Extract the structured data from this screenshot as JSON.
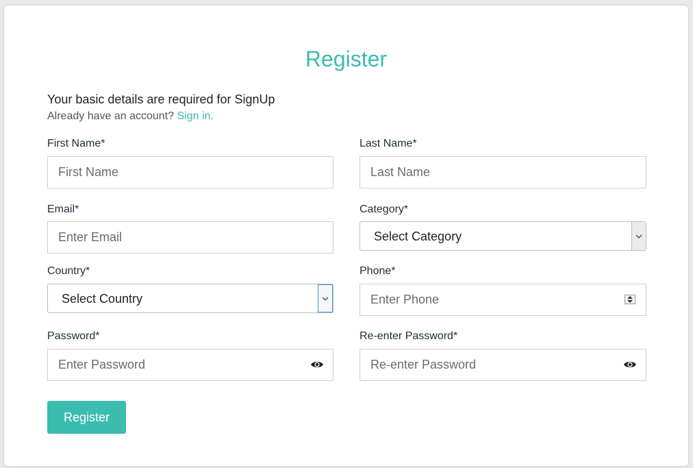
{
  "form": {
    "title": "Register",
    "subtitle": "Your basic details are required for SignUp",
    "signin_prompt": "Already have an account?",
    "signin_link": "Sign in.",
    "submit_label": "Register",
    "accent_color": "#3bbcaf"
  },
  "fields": {
    "first_name": {
      "label": "First Name*",
      "placeholder": "First Name"
    },
    "last_name": {
      "label": "Last Name*",
      "placeholder": "Last Name"
    },
    "email": {
      "label": "Email*",
      "placeholder": "Enter Email"
    },
    "category": {
      "label": "Category*",
      "selected": "Select Category"
    },
    "country": {
      "label": "Country*",
      "selected": "Select Country"
    },
    "phone": {
      "label": "Phone*",
      "placeholder": "Enter Phone"
    },
    "password": {
      "label": "Password*",
      "placeholder": "Enter Password",
      "icon": "eye-icon"
    },
    "reenter_password": {
      "label": "Re-enter Password*",
      "placeholder": "Re-enter Password",
      "icon": "eye-icon"
    }
  }
}
